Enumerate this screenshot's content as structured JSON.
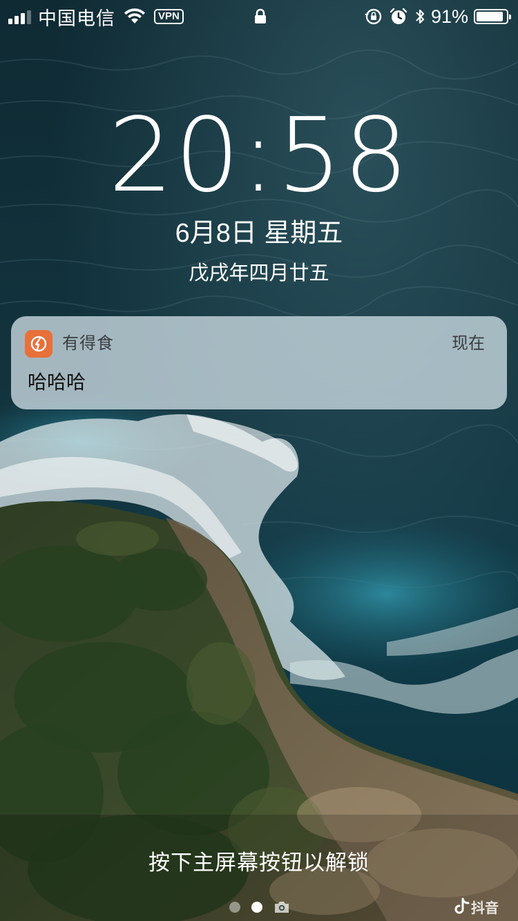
{
  "status_bar": {
    "carrier": "中国电信",
    "vpn": "VPN",
    "battery_percent": "91%",
    "battery_level": 0.91,
    "icons": [
      "signal-icon",
      "wifi-icon",
      "lock-icon",
      "rotation-lock-icon",
      "alarm-icon",
      "bluetooth-icon",
      "battery-icon"
    ]
  },
  "lock_screen": {
    "time": "20:58",
    "date": "6月8日 星期五",
    "lunar_date": "戊戌年四月廿五"
  },
  "notification": {
    "app_name": "有得食",
    "time": "现在",
    "message": "哈哈哈",
    "icon_color": "#e8703a"
  },
  "bottom": {
    "unlock_hint": "按下主屏幕按钮以解锁",
    "pages": [
      "dot",
      "dot-active",
      "camera-icon"
    ],
    "watermark": "抖音"
  }
}
